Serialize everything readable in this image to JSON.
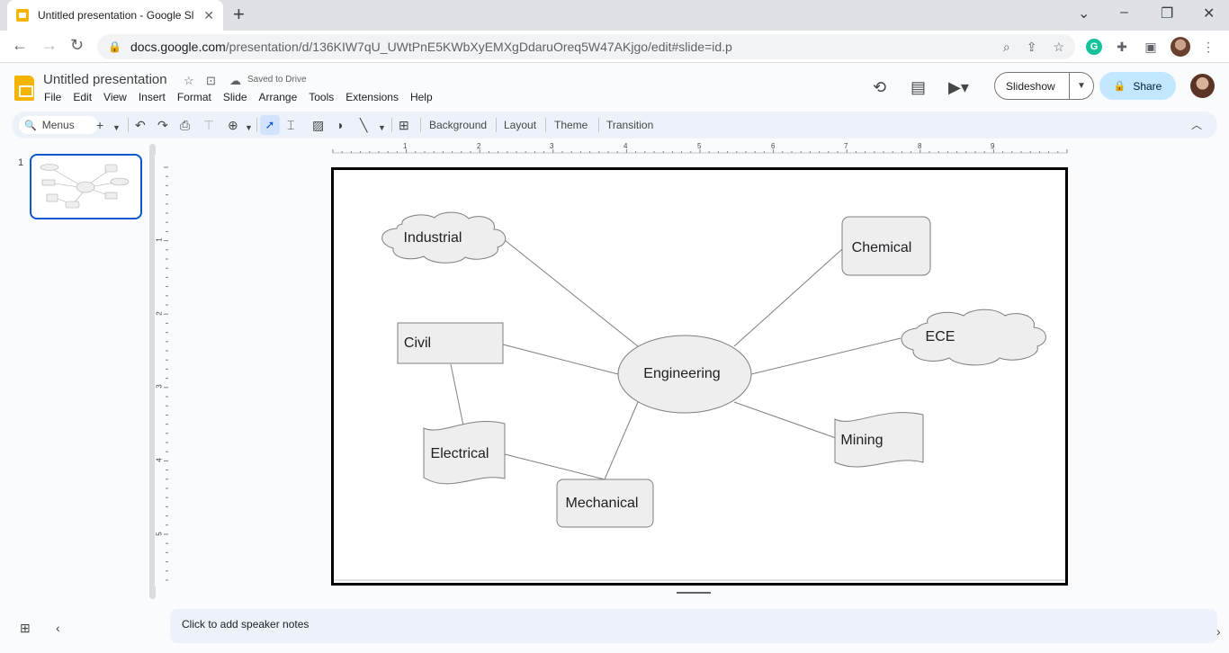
{
  "browser": {
    "tab_title": "Untitled presentation - Google Sl",
    "url_host": "docs.google.com",
    "url_path": "/presentation/d/136KIW7qU_UWtPnE5KWbXyEMXgDdaruOreq5W47AKjgo/edit#slide=id.p"
  },
  "docs": {
    "title": "Untitled presentation",
    "saved_status": "Saved to Drive",
    "menu": [
      "File",
      "Edit",
      "View",
      "Insert",
      "Format",
      "Slide",
      "Arrange",
      "Tools",
      "Extensions",
      "Help"
    ],
    "slideshow_label": "Slideshow",
    "share_label": "Share"
  },
  "toolbar": {
    "search_label": "Menus",
    "background_label": "Background",
    "layout_label": "Layout",
    "theme_label": "Theme",
    "transition_label": "Transition"
  },
  "rulers": {
    "horizontal": [
      "1",
      "2",
      "3",
      "4",
      "5",
      "6",
      "7",
      "8",
      "9"
    ],
    "vertical": [
      "1",
      "2",
      "3",
      "4",
      "5"
    ]
  },
  "filmstrip": {
    "slide_number": "1"
  },
  "diagram": {
    "center": "Engineering",
    "nodes": [
      "Industrial",
      "Chemical",
      "Civil",
      "ECE",
      "Electrical",
      "Mining",
      "Mechanical"
    ]
  },
  "notes_placeholder": "Click to add speaker notes",
  "icons": {
    "browser": [
      "back-icon",
      "forward-icon",
      "reload-icon",
      "lock-icon",
      "zoom-icon",
      "share-page-icon",
      "star-icon",
      "grammarly-icon",
      "extensions-icon",
      "side-panel-icon",
      "menu-icon"
    ],
    "docs": [
      "star-icon",
      "move-folder-icon",
      "cloud-icon",
      "history-icon",
      "comment-icon",
      "meet-icon",
      "lock-icon"
    ]
  },
  "colors": {
    "shape_fill": "#eeeeee",
    "shape_stroke": "#7f7f7f",
    "share_bg": "#c2e7ff",
    "toolbar_bg": "#edf2fa",
    "selected_thumb": "#0b57d0"
  }
}
